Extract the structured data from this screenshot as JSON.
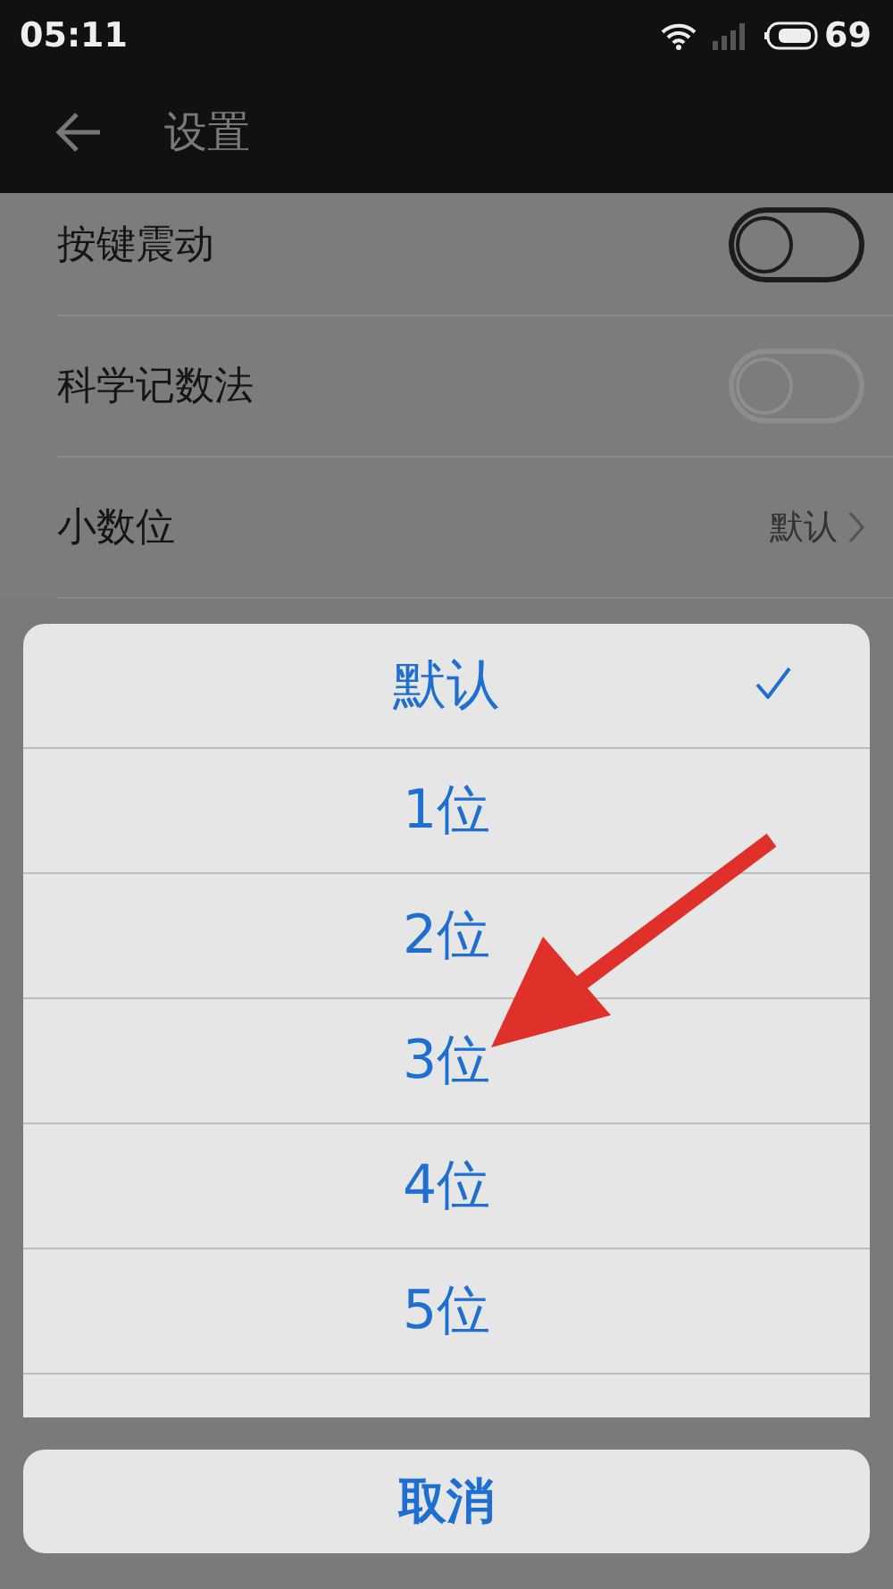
{
  "status_bar": {
    "time": "05:11",
    "battery": "69"
  },
  "toolbar": {
    "title": "设置"
  },
  "sections": [
    {
      "items": [
        {
          "label": "按键震动",
          "kind": "toggle",
          "on": false,
          "disabled": false
        },
        {
          "label": "科学记数法",
          "kind": "toggle",
          "on": false,
          "disabled": true
        },
        {
          "label": "小数位",
          "kind": "value",
          "value": "默认"
        }
      ]
    }
  ],
  "sheet": {
    "options": [
      {
        "label": "默认",
        "selected": true
      },
      {
        "label": "1位",
        "selected": false
      },
      {
        "label": "2位",
        "selected": false
      },
      {
        "label": "3位",
        "selected": false
      },
      {
        "label": "4位",
        "selected": false
      },
      {
        "label": "5位",
        "selected": false
      }
    ],
    "cancel": "取消"
  }
}
